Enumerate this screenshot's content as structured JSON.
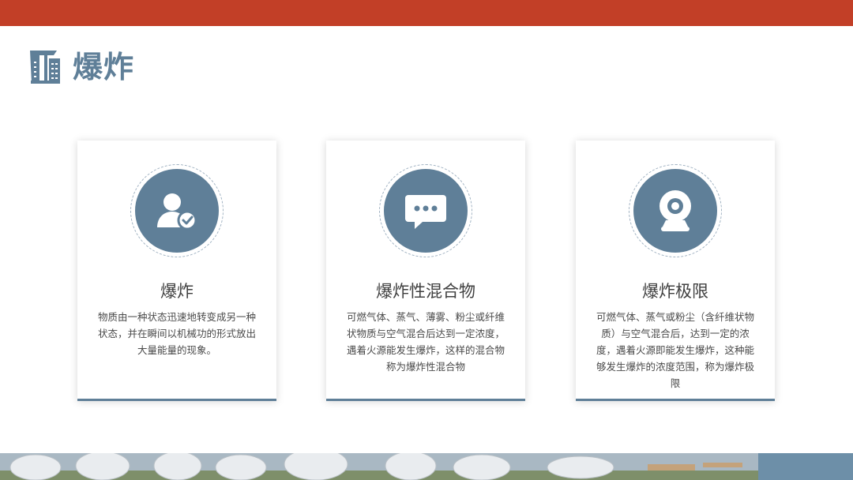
{
  "header": {
    "title": "爆炸",
    "colors": {
      "bar": "#c23f27",
      "accent": "#5f7f98"
    }
  },
  "cards": [
    {
      "icon": "user-check-icon",
      "title": "爆炸",
      "body": "物质由一种状态迅速地转变成另一种状态，并在瞬间以机械功的形式放出大量能量的现象。"
    },
    {
      "icon": "chat-bubble-icon",
      "title": "爆炸性混合物",
      "body": "可燃气体、蒸气、薄雾、粉尘或纤维状物质与空气混合后达到一定浓度，遇着火源能发生爆炸，这样的混合物称为爆炸性混合物"
    },
    {
      "icon": "webcam-icon",
      "title": "爆炸极限",
      "body": "可燃气体、蒸气或粉尘（含纤维状物质）与空气混合后，达到一定的浓度，遇着火源即能发生爆炸，这种能够发生爆炸的浓度范围，称为爆炸极限"
    }
  ],
  "footer": {
    "image": "industrial-storage-tanks-photo"
  }
}
